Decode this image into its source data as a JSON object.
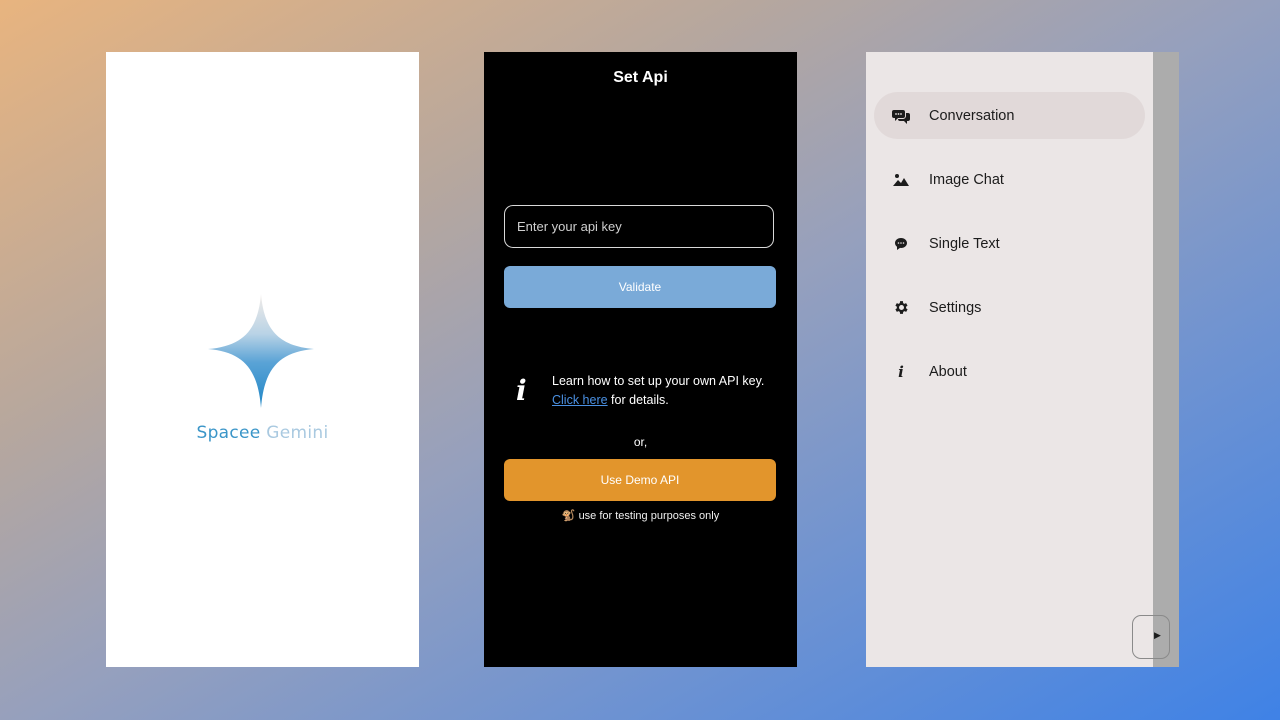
{
  "splash": {
    "brand_part1": "Spacee",
    "brand_part2": " Gemini"
  },
  "set_api": {
    "title": "Set Api",
    "input_placeholder": "Enter your api key",
    "validate_label": "Validate",
    "info_text_before": "Learn how to set up your own API key. ",
    "info_link": "Click here",
    "info_text_after": " for details.",
    "or_text": "or,",
    "demo_button_label": "Use Demo API",
    "demo_note_emoji": "🐒",
    "demo_note": "use for testing purposes only"
  },
  "drawer": {
    "items": [
      {
        "label": "Conversation",
        "icon": "chat-bubbles-icon",
        "selected": true
      },
      {
        "label": "Image Chat",
        "icon": "image-icon",
        "selected": false
      },
      {
        "label": "Single Text",
        "icon": "single-chat-icon",
        "selected": false
      },
      {
        "label": "Settings",
        "icon": "gear-icon",
        "selected": false
      },
      {
        "label": "About",
        "icon": "info-icon",
        "selected": false
      }
    ],
    "send_icon": "▶"
  },
  "colors": {
    "validate_bg": "#7aaad8",
    "demo_bg": "#e2952c",
    "link": "#4a90e2",
    "drawer_bg": "#ebe6e6",
    "selected_bg": "#e1d9d9"
  }
}
